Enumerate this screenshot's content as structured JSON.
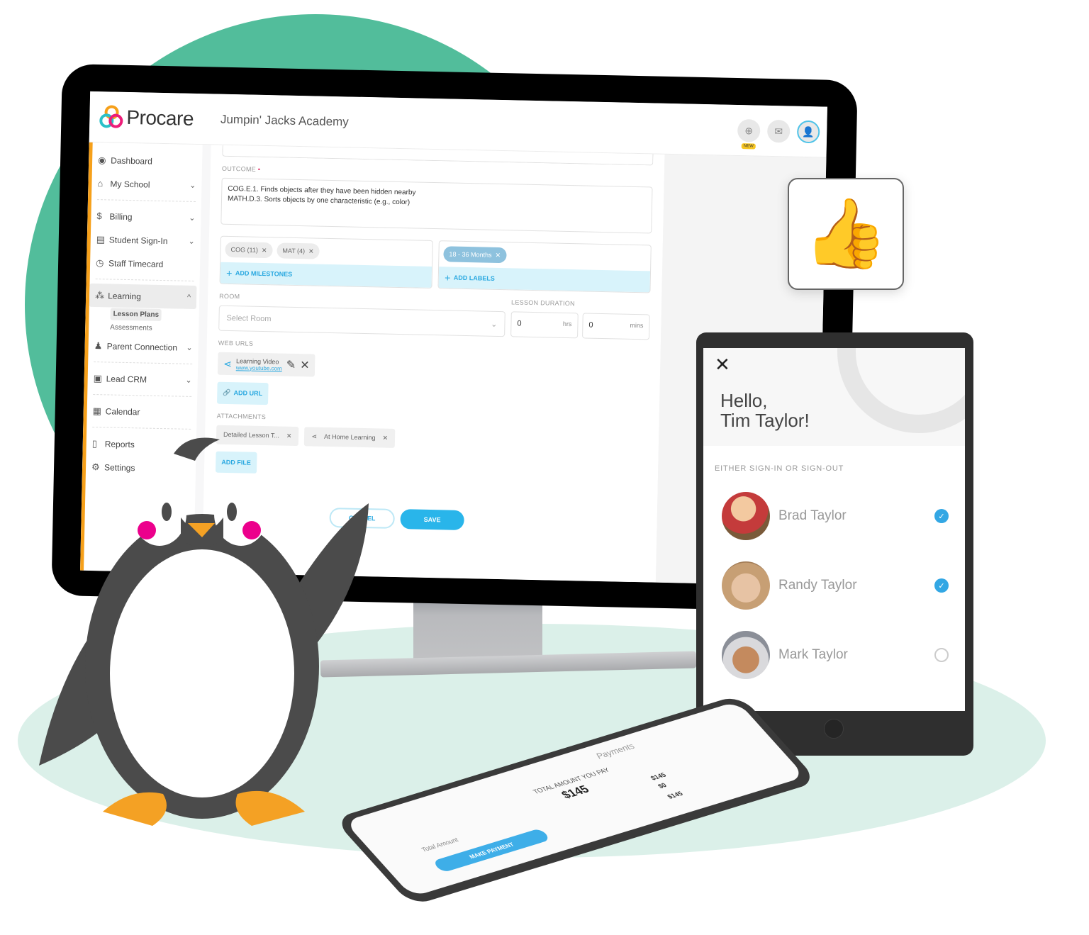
{
  "app": {
    "brand": "Procare",
    "school_name": "Jumpin' Jacks Academy",
    "header_icons": [
      "plus-circle-icon",
      "mail-icon",
      "user-avatar-icon"
    ],
    "new_badge": "NEW"
  },
  "sidebar": {
    "items": [
      {
        "label": "Dashboard",
        "icon": "dashboard-icon",
        "chevron": ""
      },
      {
        "label": "My School",
        "icon": "school-icon",
        "chevron": "⌄"
      },
      {
        "label": "Billing",
        "icon": "billing-icon",
        "chevron": "⌄"
      },
      {
        "label": "Student Sign-In",
        "icon": "sign-in-icon",
        "chevron": "⌄"
      },
      {
        "label": "Staff Timecard",
        "icon": "timecard-icon",
        "chevron": ""
      },
      {
        "label": "Learning",
        "icon": "learning-icon",
        "chevron": "^"
      },
      {
        "label": "Parent Connection",
        "icon": "parent-icon",
        "chevron": "⌄"
      },
      {
        "label": "Lead CRM",
        "icon": "crm-icon",
        "chevron": "⌄"
      },
      {
        "label": "Calendar",
        "icon": "calendar-icon",
        "chevron": ""
      },
      {
        "label": "Reports",
        "icon": "reports-icon",
        "chevron": ""
      },
      {
        "label": "Settings",
        "icon": "gear-icon",
        "chevron": ""
      }
    ],
    "learning_sub": [
      "Lesson Plans",
      "Assessments"
    ]
  },
  "form": {
    "outcome_label": "OUTCOME",
    "required_marker": "•",
    "outcome_lines": [
      "COG.E.1. Finds objects after they have been hidden nearby",
      "MATH.D.3. Sorts objects by one characteristic (e.g., color)"
    ],
    "milestones": [
      "COG (11)",
      "MAT (4)"
    ],
    "add_milestones": "ADD MILESTONES",
    "labels": [
      "18 - 36 Months"
    ],
    "add_labels": "ADD LABELS",
    "room_label": "ROOM",
    "room_placeholder": "Select Room",
    "duration_label": "LESSON DURATION",
    "hours_value": "0",
    "hours_unit": "hrs",
    "mins_value": "0",
    "mins_unit": "mins",
    "web_urls_label": "WEB URLS",
    "url_title": "Learning Video",
    "url_link": "www.youtube.com",
    "add_url": "ADD URL",
    "attachments_label": "ATTACHMENTS",
    "attachments": [
      "Detailed Lesson T...",
      "At Home Learning"
    ],
    "add_file": "ADD FILE",
    "cancel": "CANCEL",
    "save": "SAVE"
  },
  "reaction": {
    "emoji": "👍"
  },
  "tablet": {
    "close": "✕",
    "greeting_line1": "Hello,",
    "greeting_line2": "Tim Taylor!",
    "subtitle": "EITHER SIGN-IN OR SIGN-OUT",
    "children": [
      {
        "name": "Brad Taylor",
        "selected": true
      },
      {
        "name": "Randy Taylor",
        "selected": true
      },
      {
        "name": "Mark Taylor",
        "selected": false
      }
    ]
  },
  "phone": {
    "title": "Payments",
    "total_label": "TOTAL AMOUNT YOU PAY",
    "amount": "$145",
    "line_amount_1": "$145",
    "line_amount_2": "$0",
    "line_total": "$145",
    "total_amount_label": "Total Amount",
    "make_payment": "MAKE PAYMENT"
  },
  "colors": {
    "accent_blue": "#29b5ea",
    "brand_orange": "#f6a01a",
    "bg_green": "#52bd9b",
    "floor_mint": "#dbf0e9"
  }
}
